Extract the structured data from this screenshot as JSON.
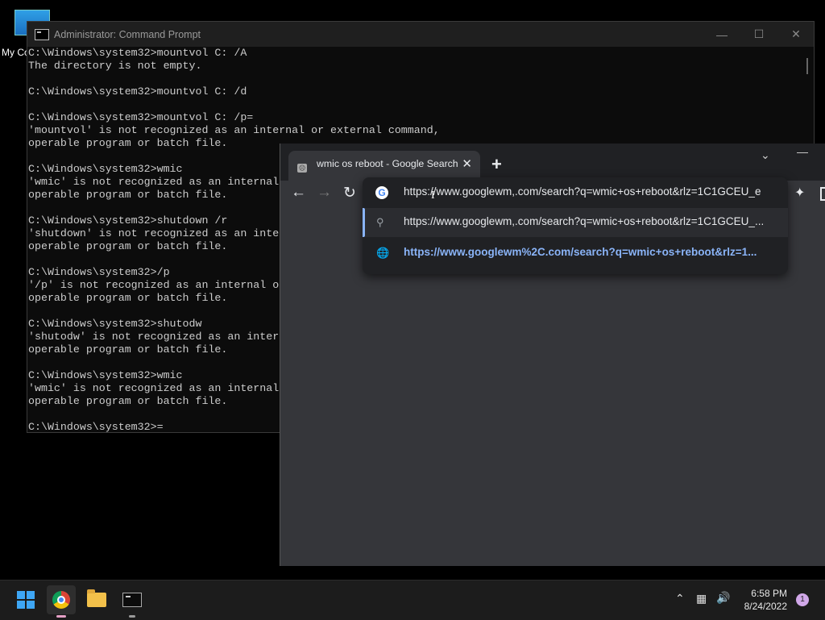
{
  "desktop": {
    "icon_label": "My Co"
  },
  "cmd": {
    "title": "Administrator: Command Prompt",
    "lines": [
      "C:\\Windows\\system32>mountvol C: /A",
      "The directory is not empty.",
      "",
      "C:\\Windows\\system32>mountvol C: /d",
      "",
      "C:\\Windows\\system32>mountvol C: /p=",
      "'mountvol' is not recognized as an internal or external command,",
      "operable program or batch file.",
      "",
      "C:\\Windows\\system32>wmic",
      "'wmic' is not recognized as an internal",
      "operable program or batch file.",
      "",
      "C:\\Windows\\system32>shutdown /r",
      "'shutdown' is not recognized as an inte",
      "operable program or batch file.",
      "",
      "C:\\Windows\\system32>/p",
      "'/p' is not recognized as an internal or",
      "operable program or batch file.",
      "",
      "C:\\Windows\\system32>shutodw",
      "'shutodw' is not recognized as an inter",
      "operable program or batch file.",
      "",
      "C:\\Windows\\system32>wmic",
      "'wmic' is not recognized as an internal",
      "operable program or batch file.",
      "",
      "C:\\Windows\\system32>="
    ]
  },
  "browser": {
    "tab_title": "wmic os reboot - Google Search",
    "omnibox_text": "https://www.googlewm,.com/search?q=wmic+os+reboot&rlz=1C1GCEU_e",
    "suggestions": [
      {
        "icon": "search-icon",
        "text": "https://www.googlewm,.com/search?q=wmic+os+reboot&rlz=1C1GCEU_..."
      },
      {
        "icon": "globe-icon",
        "text": "https://www.googlewm%2C.com/search?q=wmic+os+reboot&rlz=1..."
      }
    ]
  },
  "taskbar": {
    "time": "6:58 PM",
    "date": "8/24/2022",
    "notification_count": "1"
  }
}
